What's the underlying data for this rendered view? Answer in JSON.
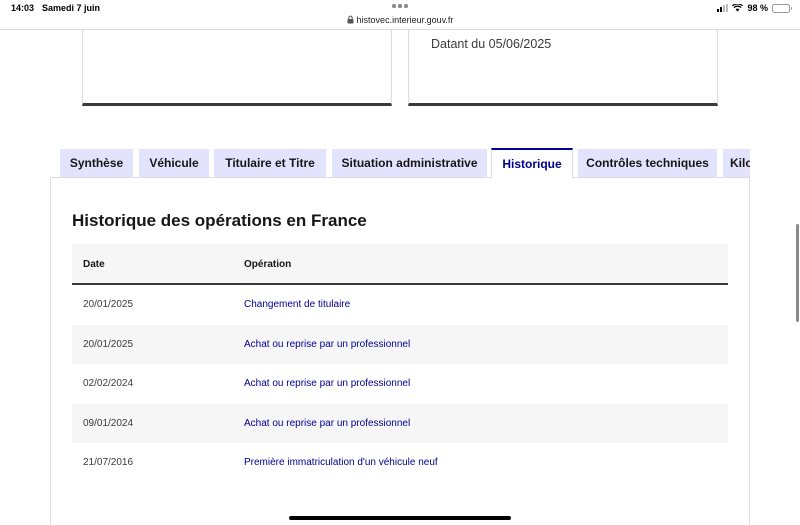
{
  "status_bar": {
    "time": "14:03",
    "date": "Samedi 7 juin",
    "url": "histovec.interieur.gouv.fr",
    "battery": "98 %",
    "battery_level": 0.98
  },
  "cards": {
    "right_text": "Datant du 05/06/2025"
  },
  "tabs": [
    {
      "label": "Synthèse",
      "active": false
    },
    {
      "label": "Véhicule",
      "active": false
    },
    {
      "label": "Titulaire et Titre",
      "active": false
    },
    {
      "label": "Situation administrative",
      "active": false
    },
    {
      "label": "Historique",
      "active": true
    },
    {
      "label": "Contrôles techniques",
      "active": false
    },
    {
      "label": "Kilo",
      "active": false
    }
  ],
  "historique": {
    "title": "Historique des opérations en France",
    "columns": {
      "date": "Date",
      "operation": "Opération"
    },
    "rows": [
      {
        "date": "20/01/2025",
        "operation": "Changement de titulaire"
      },
      {
        "date": "20/01/2025",
        "operation": "Achat ou reprise par un professionnel"
      },
      {
        "date": "02/02/2024",
        "operation": "Achat ou reprise par un professionnel"
      },
      {
        "date": "09/01/2024",
        "operation": "Achat ou reprise par un professionnel"
      },
      {
        "date": "21/07/2016",
        "operation": "Première immatriculation d'un véhicule neuf"
      }
    ]
  },
  "colors": {
    "accent": "#000091",
    "tab_inactive_bg": "#e3e3fd",
    "row_alt_bg": "#f6f6f6"
  }
}
